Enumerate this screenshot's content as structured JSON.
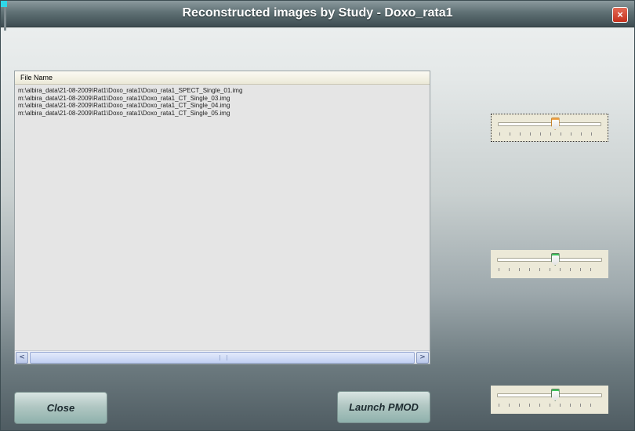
{
  "window": {
    "title": "Reconstructed images by Study - Doxo_rata1",
    "close_glyph": "×"
  },
  "file_list": {
    "column_header": "File Name",
    "rows": [
      "m:\\albira_data\\21-08-2009\\Rat1\\Doxo_rata1\\Doxo_rata1_SPECT_Single_01.img",
      "m:\\albira_data\\21-08-2009\\Rat1\\Doxo_rata1\\Doxo_rata1_CT_Single_03.img",
      "m:\\albira_data\\21-08-2009\\Rat1\\Doxo_rata1\\Doxo_rata1_CT_Single_04.img",
      "m:\\albira_data\\21-08-2009\\Rat1\\Doxo_rata1\\Doxo_rata1_CT_Single_05.img"
    ],
    "scroll_left_glyph": "<",
    "scroll_right_glyph": ">"
  },
  "sliders": [
    {
      "name": "slider-1",
      "value_fraction": 0.55,
      "handle_color": "#f2a64c",
      "focused": true
    },
    {
      "name": "slider-2",
      "value_fraction": 0.55,
      "handle_color": "#3cc25a",
      "focused": false
    },
    {
      "name": "slider-3",
      "value_fraction": 0.55,
      "handle_color": "#3cc25a",
      "focused": false
    }
  ],
  "buttons": {
    "close_label": "Close",
    "launch_label": "Launch PMOD"
  }
}
